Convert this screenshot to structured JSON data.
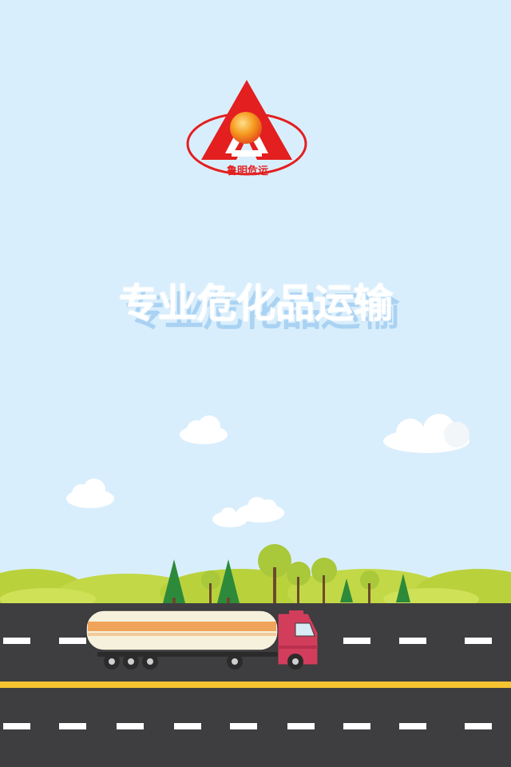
{
  "logo": {
    "brand_text": "鲁明危运",
    "colors": {
      "triangle": "#e31f1f",
      "sun": "#f08a1a",
      "ring": "#e31f1f"
    }
  },
  "slogan": {
    "text": "专业危化品运输"
  },
  "scene": {
    "colors": {
      "sky": "#d9eefc",
      "grass": "#b9d23c",
      "road": "#3e3e40",
      "lane_marking": "#ffffff",
      "center_line": "#f6c331"
    },
    "truck": {
      "cab_color": "#d33d5c",
      "tank_color": "#f6f1dc",
      "stripe_color": "#f0a35a"
    }
  }
}
